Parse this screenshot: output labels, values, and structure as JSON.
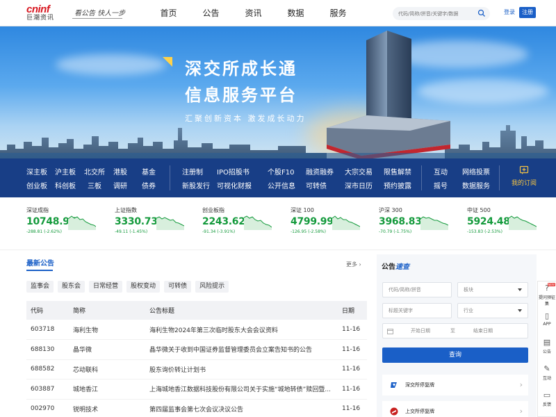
{
  "header": {
    "logo_en": "cninf",
    "logo_cn": "巨潮资讯",
    "slogan": "看公告 快人一步",
    "nav": [
      "首页",
      "公告",
      "资讯",
      "数据",
      "服务"
    ],
    "search_placeholder": "代码/简称/拼音/关键字/数据",
    "login": "登录",
    "register": "注册"
  },
  "banner": {
    "title_line1": "深交所成长通",
    "title_line2": "信息服务平台",
    "subtitle": "汇聚创新资本 激发成长动力"
  },
  "quick_links": {
    "groups": [
      [
        [
          "深主板",
          "创业板"
        ],
        [
          "沪主板",
          "科创板"
        ],
        [
          "北交所",
          "三板"
        ],
        [
          "港股",
          "调研"
        ],
        [
          "基金",
          "债券"
        ]
      ],
      [
        [
          "注册制",
          "新股发行"
        ],
        [
          "IPO招股书",
          "可视化财报"
        ],
        [
          "个股F10",
          "公开信息"
        ],
        [
          "融资融券",
          "可转债"
        ],
        [
          "大宗交易",
          "深市日历"
        ],
        [
          "限售解禁",
          "预约披露"
        ]
      ],
      [
        [
          "互动",
          "摇号"
        ],
        [
          "网络投票",
          "数据服务"
        ]
      ]
    ],
    "subscribe": "我的订阅"
  },
  "indices": [
    {
      "name": "深证成指",
      "value": "10748.97",
      "change": "-288.81 (-2.62%)"
    },
    {
      "name": "上证指数",
      "value": "3330.73",
      "change": "-49.11 (-1.45%)"
    },
    {
      "name": "创业板指",
      "value": "2243.62",
      "change": "-91.34 (-3.91%)"
    },
    {
      "name": "深证 100",
      "value": "4799.99",
      "change": "-126.95 (-2.58%)"
    },
    {
      "name": "沪深 300",
      "value": "3968.83",
      "change": "-70.79 (-1.75%)"
    },
    {
      "name": "中证 500",
      "value": "5924.48",
      "change": "-153.83 (-2.53%)"
    }
  ],
  "announcements": {
    "title": "最新公告",
    "more": "更多",
    "tabs": [
      "监事会",
      "股东会",
      "日常经营",
      "股权变动",
      "可转债",
      "风险提示"
    ],
    "columns": [
      "代码",
      "简称",
      "公告标题",
      "日期"
    ],
    "rows": [
      [
        "603718",
        "海利生物",
        "海利生物2024年第三次临时股东大会会议资料",
        "11-16"
      ],
      [
        "688130",
        "晶华微",
        "晶华微关于收到中国证券监督管理委员会立案告知书的公告",
        "11-16"
      ],
      [
        "688582",
        "芯动联科",
        "股东询价转让计划书",
        "11-16"
      ],
      [
        "603887",
        "城地香江",
        "上海城地香江数据科技股份有限公司关于实施“城地转债”赎回暨...",
        "11-16"
      ],
      [
        "002970",
        "锐明技术",
        "第四届监事会第七次会议决议公告",
        "11-16"
      ]
    ]
  },
  "quick_search": {
    "title_a": "公告",
    "title_b": "速查",
    "code_placeholder": "代码/简称/拼音",
    "sector": "板块",
    "keyword_placeholder": "标题关键字",
    "industry": "行业",
    "start_date": "开始日期",
    "to": "至",
    "end_date": "结束日期",
    "button": "查询",
    "links": [
      "深交所停复牌",
      "上交所停复牌"
    ]
  },
  "sidebar": {
    "items": [
      "提问预征集",
      "APP",
      "公告",
      "互动",
      "反馈"
    ],
    "new_badge": "NEW"
  },
  "colors": {
    "brand_blue": "#1a5fc7",
    "nav_dark": "#183e86",
    "down_green": "#149a3c",
    "logo_red": "#d7161f"
  }
}
